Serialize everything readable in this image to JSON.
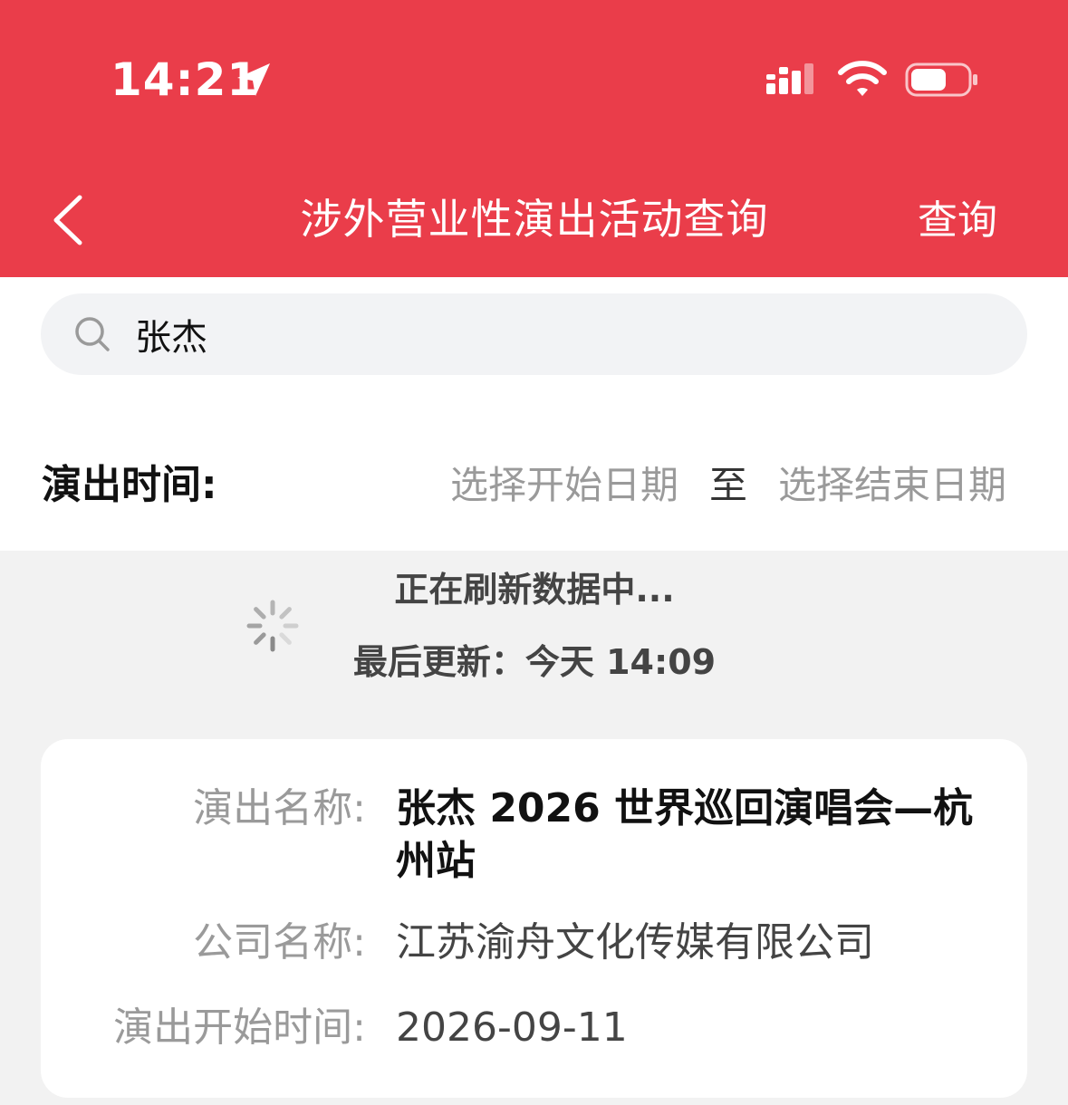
{
  "status_bar": {
    "time": "14:21",
    "icons": [
      "location-arrow-icon",
      "signal-bars-icon",
      "wifi-icon",
      "battery-icon"
    ]
  },
  "nav": {
    "back_icon": "chevron-left-icon",
    "title": "涉外营业性演出活动查询",
    "action_label": "查询"
  },
  "search": {
    "icon": "search-icon",
    "value": "张杰"
  },
  "date_filter": {
    "label": "演出时间:",
    "start_placeholder": "选择开始日期",
    "separator": "至",
    "end_placeholder": "选择结束日期"
  },
  "refresh": {
    "icon": "spinner-icon",
    "status": "正在刷新数据中...",
    "last_update": "最后更新：今天 14:09"
  },
  "result": {
    "rows": [
      {
        "label": "演出名称:",
        "value": "张杰 2026 世界巡回演唱会—杭州站"
      },
      {
        "label": "公司名称:",
        "value": "江苏渝舟文化传媒有限公司"
      },
      {
        "label": "演出开始时间:",
        "value": "2026-09-11"
      }
    ]
  },
  "colors": {
    "header_red": "#ea3d4a",
    "page_bg": "#f2f2f2",
    "label_gray": "#9a9a9a"
  }
}
